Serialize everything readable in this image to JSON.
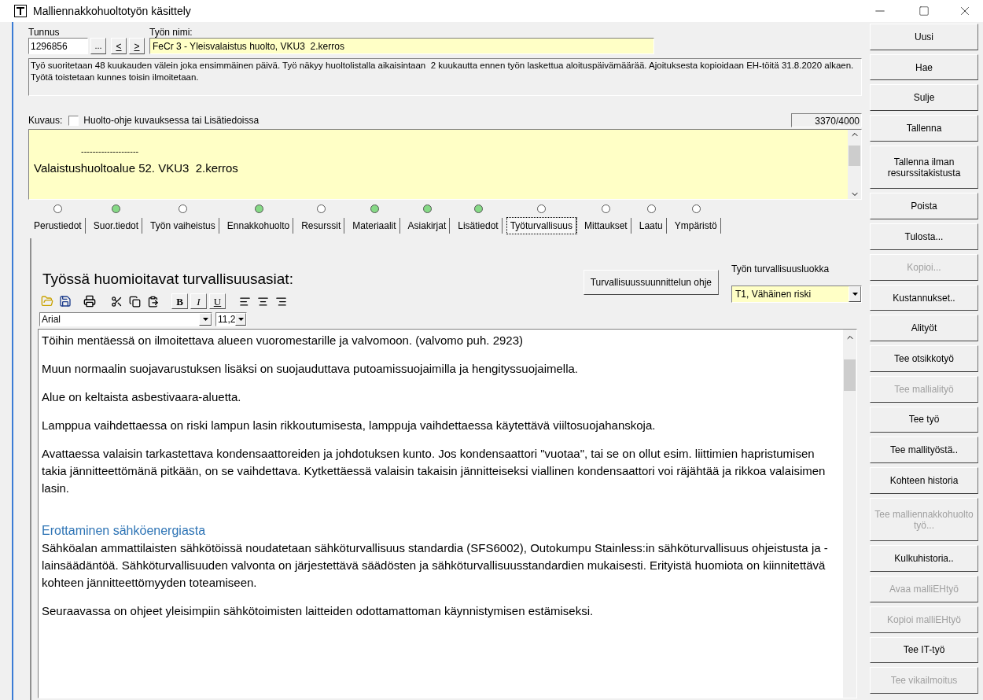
{
  "window": {
    "title": "Malliennakkohuoltotyön käsittely"
  },
  "header": {
    "id_label": "Tunnus",
    "id_value": "1296856",
    "browse_button": "...",
    "prev_button": "<",
    "next_button": ">",
    "name_label": "Työn nimi:",
    "name_value": "FeCr 3 - Yleisvalaistus huolto, VKU3  2.kerros"
  },
  "schedule_text": "Työ suoritetaan 48 kuukauden välein joka ensimmäinen päivä. Työ näkyy huoltolistalla aikaisintaan  2 kuukautta ennen työn laskettua aloituspäivämäärää. Ajoituksesta kopioidaan EH-töitä 31.8.2020 alkaen. Työtä toistetaan kunnes toisin ilmoitetaan.",
  "description": {
    "label": "Kuvaus:",
    "checkbox": {
      "label": "Huolto-ohje kuvauksessa tai Lisätiedoissa",
      "checked": false
    },
    "counter": "3370/4000",
    "lines": [
      {
        "kind": "separator",
        "text": "--------------------"
      },
      {
        "kind": "title",
        "text": "Valaistushuoltoalue 52. VKU3  2.kerros"
      }
    ]
  },
  "tabs": [
    {
      "label": "Perustiedot",
      "indicator": false,
      "selected": false
    },
    {
      "label": "Suor.tiedot",
      "indicator": true,
      "selected": false
    },
    {
      "label": "Työn vaiheistus",
      "indicator": false,
      "selected": false
    },
    {
      "label": "Ennakkohuolto",
      "indicator": true,
      "selected": false
    },
    {
      "label": "Resurssit",
      "indicator": false,
      "selected": false
    },
    {
      "label": "Materiaalit",
      "indicator": true,
      "selected": false
    },
    {
      "label": "Asiakirjat",
      "indicator": true,
      "selected": false
    },
    {
      "label": "Lisätiedot",
      "indicator": true,
      "selected": false
    },
    {
      "label": "Työturvallisuus",
      "indicator": false,
      "selected": true
    },
    {
      "label": "Mittaukset",
      "indicator": false,
      "selected": false
    },
    {
      "label": "Laatu",
      "indicator": false,
      "selected": false
    },
    {
      "label": "Ympäristö",
      "indicator": false,
      "selected": false
    }
  ],
  "safety": {
    "heading": "Työssä huomioitavat turvallisuusasiat:",
    "guide_button": "Turvallisuussuunnittelun ohje",
    "class_label": "Työn turvallisuusluokka",
    "class_value": "T1, Vähäinen riski",
    "format_buttons": [
      "B",
      "I",
      "U"
    ],
    "font": "Arial",
    "font_size": "11,2",
    "paragraphs": [
      {
        "kind": "paragraph",
        "text": "Töihin mentäessä on ilmoitettava alueen vuoromestarille ja valvomoon. (valvomo puh. 2923)"
      },
      {
        "kind": "paragraph",
        "text": "Muun normaalin suojavarustuksen lisäksi on suojauduttava putoamissuojaimilla ja hengityssuojaimella."
      },
      {
        "kind": "paragraph",
        "text": "Alue on keltaista asbestivaara-aluetta."
      },
      {
        "kind": "paragraph",
        "text": "Lamppua vaihdettaessa on riski lampun lasin rikkoutumisesta, lamppuja vaihdettaessa käytettävä viiltosuojahanskoja."
      },
      {
        "kind": "paragraph",
        "text": "Avattaessa valaisin tarkastettava kondensaattoreiden ja johdotuksen kunto. Jos kondensaattori \"vuotaa\", tai se on ollut esim. liittimien hapristumisen takia jännitteettömänä pitkään, on se vaihdettava. Kytkettäessä valaisin takaisin jännitteiseksi viallinen kondensaattori voi räjähtää ja rikkoa valaisimen lasin."
      },
      {
        "kind": "heading",
        "text": "Erottaminen sähköenergiasta"
      },
      {
        "kind": "paragraph",
        "text": "Sähköalan ammattilaisten sähkötöissä noudatetaan sähköturvallisuus standardia (SFS6002), Outokumpu Stainless:in sähköturvallisuus ohjeistusta ja -lainsäädäntöä. Sähköturvallisuuden valvonta on järjestettävä säädösten ja sähköturvallisuusstandardien mukaisesti. Erityistä huomiota on kiinnitettävä kohteen jännitteettömyyden toteamiseen."
      },
      {
        "kind": "paragraph",
        "text": "Seuraavassa on ohjeet yleisimpiin sähkötoimisten laitteiden odottamattoman käynnistymisen estämiseksi."
      }
    ]
  },
  "buttons": [
    {
      "label": "Uusi",
      "disabled": false
    },
    {
      "label": "Hae",
      "disabled": false
    },
    {
      "label": "Sulje",
      "disabled": false
    },
    {
      "label": "Tallenna",
      "disabled": false
    },
    {
      "label": "Tallenna ilman resurssitakistusta",
      "disabled": false
    },
    {
      "label": "Poista",
      "disabled": false
    },
    {
      "label": "Tulosta...",
      "disabled": false
    },
    {
      "label": "Kopioi...",
      "disabled": true
    },
    {
      "label": "Kustannukset..",
      "disabled": false
    },
    {
      "label": "Alityöt",
      "disabled": false
    },
    {
      "label": "Tee otsikkotyö",
      "disabled": false
    },
    {
      "label": "Tee mallialityö",
      "disabled": true
    },
    {
      "label": "Tee työ",
      "disabled": false
    },
    {
      "label": "Tee mallityöstä..",
      "disabled": false
    },
    {
      "label": "Kohteen historia",
      "disabled": false
    },
    {
      "label": "Tee malliennakkohuolto työ...",
      "disabled": true
    },
    {
      "label": "Kulkuhistoria..",
      "disabled": false
    },
    {
      "label": "Avaa malliEHtyö",
      "disabled": true
    },
    {
      "label": "Kopioi malliEHtyö",
      "disabled": true
    },
    {
      "label": "Tee IT-työ",
      "disabled": false
    },
    {
      "label": "Tee vikailmoitus",
      "disabled": true
    }
  ]
}
